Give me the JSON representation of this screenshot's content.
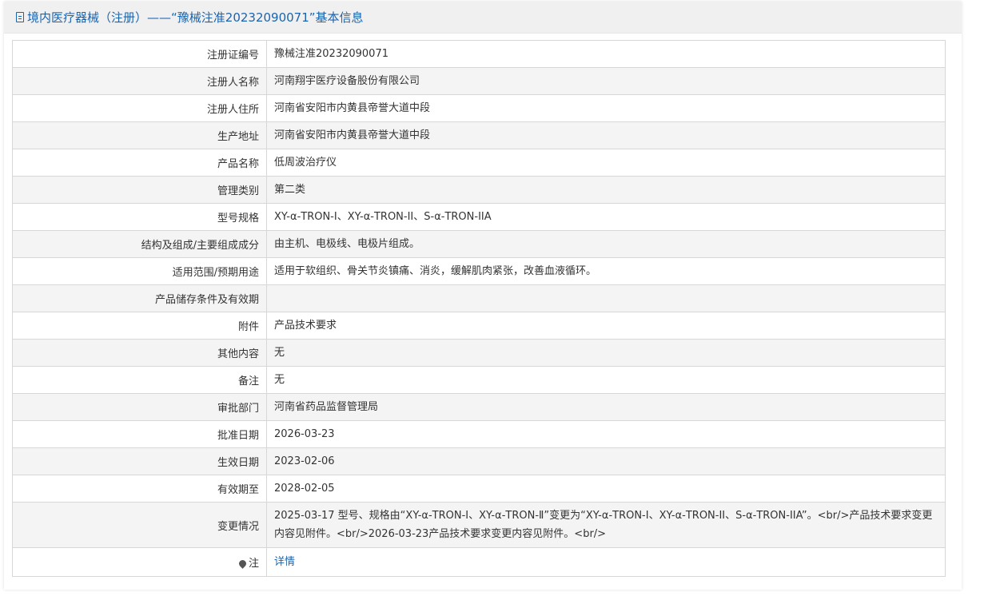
{
  "header": {
    "title": "境内医疗器械（注册）——“豫械注准20232090071”基本信息",
    "icon": "document-icon",
    "accent_color": "#1b64ad"
  },
  "rows": [
    {
      "label": "注册证编号",
      "value": "豫械注准20232090071"
    },
    {
      "label": "注册人名称",
      "value": "河南翔宇医疗设备股份有限公司"
    },
    {
      "label": "注册人住所",
      "value": "河南省安阳市内黄县帝誉大道中段"
    },
    {
      "label": "生产地址",
      "value": "河南省安阳市内黄县帝誉大道中段"
    },
    {
      "label": "产品名称",
      "value": "低周波治疗仪"
    },
    {
      "label": "管理类别",
      "value": "第二类"
    },
    {
      "label": "型号规格",
      "value": "XY-α-TRON-I、XY-α-TRON-II、S-α-TRON-IIA"
    },
    {
      "label": "结构及组成/主要组成成分",
      "value": "由主机、电极线、电极片组成。"
    },
    {
      "label": "适用范围/预期用途",
      "value": "适用于软组织、骨关节炎镇痛、消炎，缓解肌肉紧张，改善血液循环。"
    },
    {
      "label": "产品储存条件及有效期",
      "value": ""
    },
    {
      "label": "附件",
      "value": "产品技术要求"
    },
    {
      "label": "其他内容",
      "value": "无"
    },
    {
      "label": "备注",
      "value": "无"
    },
    {
      "label": "审批部门",
      "value": "河南省药品监督管理局"
    },
    {
      "label": "批准日期",
      "value": "2026-03-23"
    },
    {
      "label": "生效日期",
      "value": "2023-02-06"
    },
    {
      "label": "有效期至",
      "value": "2028-02-05"
    },
    {
      "label": "变更情况",
      "value": "2025-03-17 型号、规格由“XY-α-TRON-Ⅰ、XY-α-TRON-Ⅱ”变更为“XY-α-TRON-I、XY-α-TRON-II、S-α-TRON-IIA”。<br/>产品技术要求变更内容见附件。<br/>2026-03-23产品技术要求变更内容见附件。<br/>"
    }
  ],
  "note": {
    "label": "注",
    "icon": "pin-icon",
    "link_text": "详情"
  }
}
